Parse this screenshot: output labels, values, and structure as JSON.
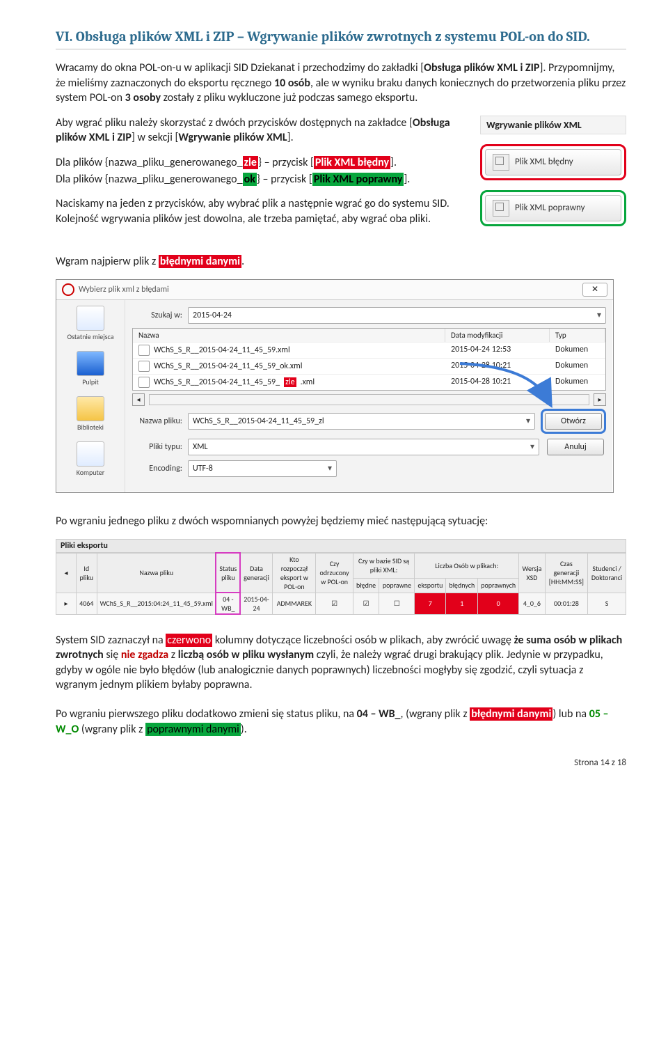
{
  "section_title": "VI. Obsługa plików XML i ZIP – Wgrywanie plików zwrotnych z systemu POL-on do SID.",
  "p1_a": "Wracamy do okna POL-on-u w aplikacji SID Dziekanat i przechodzimy do zakładki [",
  "p1_b": "Obsługa plików XML i ZIP",
  "p1_c": "]. Przypomnijmy, że mieliśmy zaznaczonych do eksportu ręcznego ",
  "p1_d": "10 osób",
  "p1_e": ", ale w wyniku braku danych koniecznych do przetworzenia pliku przez system POL-on ",
  "p1_f": "3 osoby",
  "p1_g": " zostały z pliku wykluczone już podczas samego eksportu.",
  "p2_a": "Aby wgrać pliku należy skorzystać z dwóch przycisków dostępnych na zakładce [",
  "p2_b": "Obsługa plików XML i ZIP",
  "p2_c": "] w sekcji [",
  "p2_d": "Wgrywanie plików XML",
  "p2_e": "].",
  "p3_a": "Dla plików {nazwa_pliku_generowanego_",
  "p3_zle": "zle",
  "p3_b": "} – przycisk [",
  "p3_btn": "Plik XML błędny",
  "p3_c": "].",
  "p4_a": "Dla plików {nazwa_pliku_generowanego_",
  "p4_ok": "ok",
  "p4_b": "} – przycisk [",
  "p4_btn": "Plik XML poprawny",
  "p4_c": "].",
  "p5": "Naciskamy na jeden z przycisków, aby wybrać plik a następnie wgrać go do systemu SID. Kolejność wgrywania plików jest dowolna, ale trzeba pamiętać, aby wgrać oba pliki.",
  "panel": {
    "title": "Wgrywanie plików XML",
    "btn_err": "Plik XML błędny",
    "btn_ok": "Plik XML poprawny"
  },
  "p6_a": "Wgram najpierw plik z ",
  "p6_b": "błędnymi danymi",
  "p6_c": ".",
  "dialog": {
    "title": "Wybierz plik xml z błędami",
    "close": "✕",
    "lbl_search": "Szukaj w:",
    "search_val": "2015-04-24",
    "places": {
      "recent": "Ostatnie miejsca",
      "desktop": "Pulpit",
      "libs": "Biblioteki",
      "computer": "Komputer"
    },
    "cols": {
      "name": "Nazwa",
      "date": "Data modyfikacji",
      "type": "Typ"
    },
    "rows": [
      {
        "name_a": "WChS_S_R__2015-04-24_11_45_59.xml",
        "zle": "",
        "date": "2015-04-24 12:53",
        "type": "Dokumen"
      },
      {
        "name_a": "WChS_S_R__2015-04-24_11_45_59_ok.xml",
        "zle": "",
        "date": "2015-04-28 10:21",
        "type": "Dokumen"
      },
      {
        "name_a": "WChS_S_R__2015-04-24_11_45_59_",
        "zle": "zle",
        "name_b": ".xml",
        "date": "2015-04-28 10:21",
        "type": "Dokumen"
      }
    ],
    "lbl_fname": "Nazwa pliku:",
    "fname_val": "WChS_S_R__2015-04-24_11_45_59_zl",
    "lbl_ftype": "Pliki typu:",
    "ftype_val": "XML",
    "lbl_enc": "Encoding:",
    "enc_val": "UTF-8",
    "btn_open": "Otwórz",
    "btn_cancel": "Anuluj"
  },
  "p7": "Po wgraniu jednego pliku z dwóch wspomnianych powyżej będziemy mieć następującą sytuację:",
  "exp": {
    "title": "Pliki eksportu",
    "h": {
      "id": "Id pliku",
      "name": "Nazwa pliku",
      "status": "Status pliku",
      "date": "Data generacji",
      "who": "Kto rozpoczął eksport w POL-on",
      "rej": "Czy odrzucony w POL-on",
      "inbase": "Czy w bazie SID są pliki XML:",
      "count": "Liczba Osób w plikach:",
      "xsd": "Wersja XSD",
      "time": "Czas generacji [HH:MM:SS]",
      "stud": "Studenci / Doktoranci",
      "sub_err": "błędne",
      "sub_ok": "poprawne",
      "sub_eks": "eksportu",
      "sub_berr": "błędnych",
      "sub_bok": "poprawnych"
    },
    "row": {
      "id": "4064",
      "name": "WChS_S_R__2015:04:24_11_45_59.xml",
      "status": "04 - WB_",
      "date": "2015-04-24",
      "who": "ADMMAREK",
      "rej": "☑",
      "berr": "☑",
      "bok": "☐",
      "c_eks": "7",
      "c_err": "1",
      "c_ok": "0",
      "xsd": "4_0_6",
      "time": "00:01:28",
      "stud": "S"
    }
  },
  "p8_a": "System SID zaznaczył na ",
  "p8_cz": "czerwono",
  "p8_b": " kolumny dotyczące liczebności osób w plikach, aby zwrócić uwagę ",
  "p8_c": "że suma osób w plikach zwrotnych",
  "p8_d": " się ",
  "p8_e": "nie zgadza",
  "p8_f": " z ",
  "p8_g": "liczbą osób w pliku wysłanym",
  "p8_h": " czyli, że należy wgrać drugi brakujący plik. Jedynie w przypadku, gdyby w ogóle nie było błędów (lub analogicznie danych poprawnych) liczebności mogłyby się zgodzić, czyli sytuacja z wgranym jednym plikiem byłaby poprawna.",
  "p9_a": "Po wgraniu pierwszego pliku dodatkowo zmieni się status pliku, na ",
  "p9_b": "04 – WB_",
  "p9_c": ", (wgrany plik z ",
  "p9_d": "błędnymi danymi",
  "p9_e": ") lub na ",
  "p9_f": "05 – W_O",
  "p9_g": " (wgrany plik z ",
  "p9_h": "poprawnymi danymi",
  "p9_i": ").",
  "footer": "Strona 14 z 18"
}
